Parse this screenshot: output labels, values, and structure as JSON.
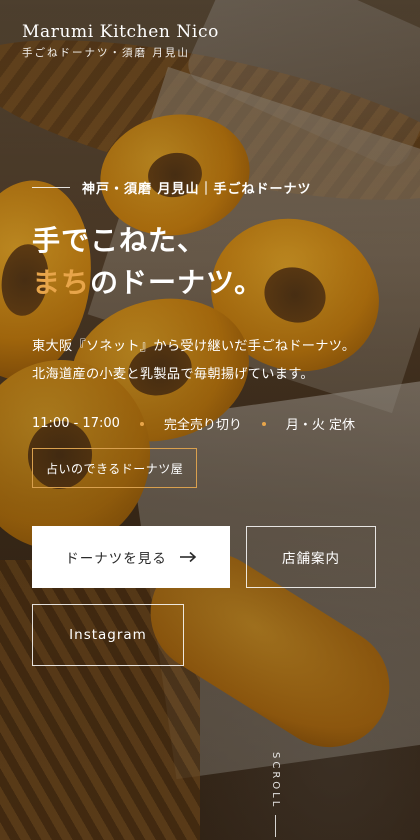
{
  "header": {
    "brand": "Marumi Kitchen Nico",
    "subtitle": "手ごねドーナツ・須磨 月見山"
  },
  "hero": {
    "eyebrow": "神戸・須磨 月見山｜手ごねドーナツ",
    "headline_line1": "手でこねた、",
    "headline_accent": "まち",
    "headline_rest": "のドーナツ。",
    "desc_line1": "東大阪『ソネット』から受け継いだ手ごねドーナツ。",
    "desc_line2": "北海道産の小麦と乳製品で毎朝揚げています。",
    "hours": "11:00 - 17:00",
    "sellout": "完全売り切り",
    "closed": "月・火 定休",
    "tag": "占いのできるドーナツ屋"
  },
  "buttons": {
    "primary": "ドーナツを見る",
    "store": "店舗案内",
    "instagram": "Instagram"
  },
  "scroll": {
    "label": "SCROLL"
  },
  "colors": {
    "accent": "#e8a54a",
    "tag_border": "#d9a04e"
  },
  "icons": {
    "arrow": "arrow-right-icon"
  }
}
